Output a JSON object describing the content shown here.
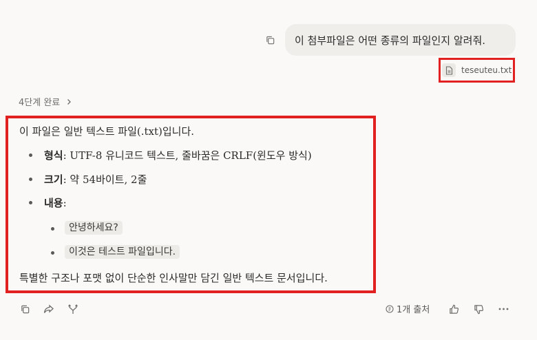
{
  "user_message": {
    "text": "이 첨부파일은 어떤 종류의 파일인지 알려줘.",
    "attachment_name": "teseuteu.txt"
  },
  "steps": {
    "label": "4단계 완료"
  },
  "answer": {
    "intro": "이 파일은 일반 텍스트 파일(.txt)입니다.",
    "items": [
      {
        "label": "형식",
        "text": ": UTF-8 유니코드 텍스트, 줄바꿈은 CRLF(윈도우 방식)"
      },
      {
        "label": "크기",
        "text": ": 약 54바이트, 2줄"
      },
      {
        "label": "내용",
        "text": ":"
      }
    ],
    "content_lines": [
      "안녕하세요?",
      "이것은 테스트 파일입니다."
    ],
    "outro": "특별한 구조나 포맷 없이 단순한 인사말만 담긴 일반 텍스트 문서입니다."
  },
  "toolbar": {
    "sources_label": "1개 출처"
  },
  "colors": {
    "highlight": "#e0211f",
    "bubble": "#efeeeb",
    "background": "#faf9f7"
  },
  "icons": [
    "copy-icon",
    "file-icon",
    "chevron-right-icon",
    "share-icon",
    "branch-icon",
    "thumbs-up-icon",
    "thumbs-down-icon",
    "more-icon"
  ]
}
